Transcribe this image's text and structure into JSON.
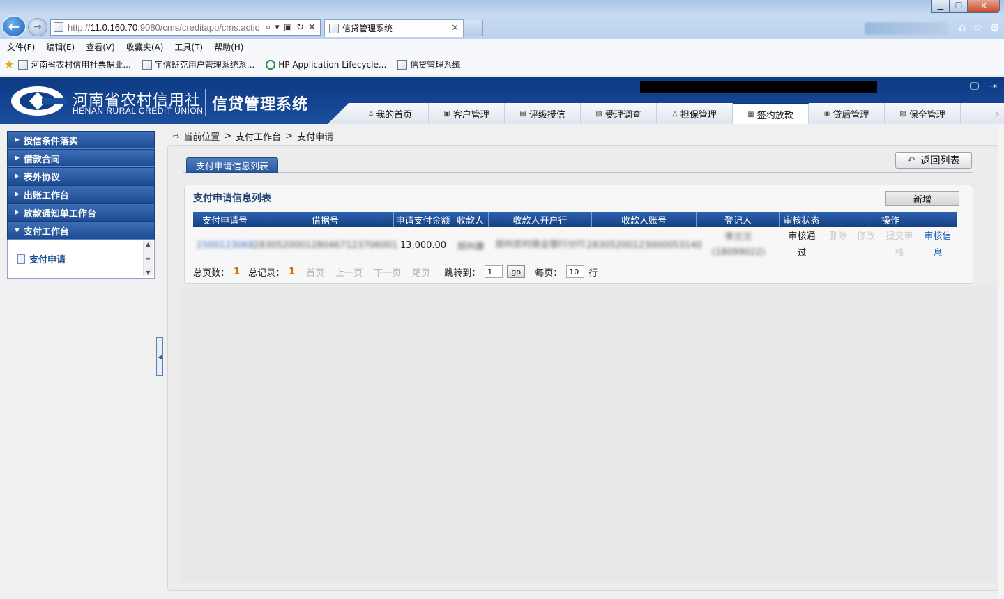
{
  "browser": {
    "url_prefix": "http://",
    "url_host": "11.0.160.70",
    "url_rest": ":9080/cms/creditapp/cms.actic",
    "tab_title": "信贷管理系统",
    "menu": [
      "文件(F)",
      "编辑(E)",
      "查看(V)",
      "收藏夹(A)",
      "工具(T)",
      "帮助(H)"
    ],
    "favorites": [
      "河南省农村信用社票据业...",
      "宇信班克用户管理系统系...",
      "HP Application Lifecycle...",
      "信贷管理系统"
    ]
  },
  "header": {
    "logo_cn": "河南省农村信用社",
    "logo_en": "HENAN RURAL CREDIT UNION",
    "system_name": "信贷管理系统",
    "nav": [
      "我的首页",
      "客户管理",
      "评级授信",
      "受理调查",
      "担保管理",
      "签约放款",
      "贷后管理",
      "保全管理"
    ],
    "active_nav": "签约放款"
  },
  "sidebar": {
    "items": [
      "授信条件落实",
      "借款合同",
      "表外协议",
      "出账工作台",
      "放款通知单工作台",
      "支付工作台"
    ],
    "expanded": "支付工作台",
    "sub_item": "支付申请"
  },
  "breadcrumb": {
    "label": "当前位置",
    "path": [
      "支付工作台",
      "支付申请"
    ]
  },
  "main": {
    "tab_label": "支付申请信息列表",
    "back_button": "返回列表",
    "card_title": "支付申请信息列表",
    "add_button": "新增",
    "columns": [
      "支付申请号",
      "借据号",
      "申请支付金额",
      "收款人",
      "收款人开户行",
      "收款人账号",
      "登记人",
      "审核状态",
      "操作"
    ],
    "rows": [
      {
        "apply_no": "1500123068",
        "loan_no": "2830520001280467123706001",
        "amount": "13,000.00",
        "payee": "郑州康",
        "payee_bank": "郑州农村商业银行分行",
        "payee_account": "28305200123000053140",
        "registrar": "李兰兰",
        "registrar_id": "(18099022)",
        "status": "审核通过",
        "ops_disabled": [
          "删除",
          "修改",
          "提交审核"
        ],
        "ops_link": "审核信息"
      }
    ],
    "pager": {
      "total_pages_label": "总页数：",
      "total_pages": "1",
      "total_records_label": "总记录：",
      "total_records": "1",
      "first": "首页",
      "prev": "上一页",
      "next": "下一页",
      "last": "尾页",
      "jump_label": "跳转到：",
      "jump_value": "1",
      "go": "go",
      "per_page_label": "每页：",
      "per_page": "10",
      "row_unit": "行"
    }
  }
}
